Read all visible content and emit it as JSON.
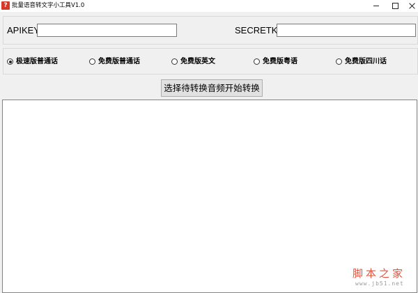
{
  "window": {
    "title": "批量语音转文字小工具V1.0",
    "app_icon_glyph": "?",
    "app_icon_color": "#d83a2a"
  },
  "keys": {
    "apikey_label": "APIKEY",
    "apikey_value": "",
    "secretkey_label": "SECRETKEY",
    "secretkey_value": ""
  },
  "modes": [
    {
      "label": "极速版普通话",
      "checked": true
    },
    {
      "label": "免费版普通话",
      "checked": false
    },
    {
      "label": "免费版英文",
      "checked": false
    },
    {
      "label": "免费版粤语",
      "checked": false
    },
    {
      "label": "免费版四川话",
      "checked": false
    }
  ],
  "actions": {
    "convert_label": "选择待转换音频开始转换"
  },
  "output": {
    "text": ""
  },
  "watermark": {
    "main": "脚本之家",
    "sub": "www.jb51.net",
    "color": "#e0533d"
  }
}
